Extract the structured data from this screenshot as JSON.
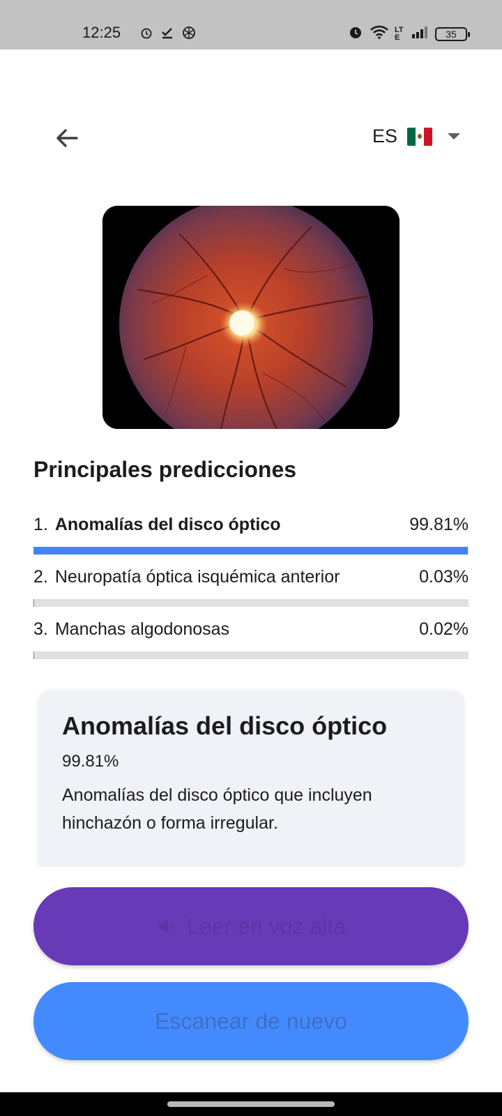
{
  "status_bar": {
    "time": "12:25",
    "battery": "35",
    "network": "LTE"
  },
  "header": {
    "language_code": "ES",
    "flag": "mexico-flag"
  },
  "predictions": {
    "title": "Principales predicciones",
    "items": [
      {
        "rank": "1.",
        "name": "Anomalías del disco óptico",
        "percent": "99.81%",
        "value": 0.9981
      },
      {
        "rank": "2.",
        "name": "Neuropatía óptica isquémica anterior",
        "percent": "0.03%",
        "value": 0.0003
      },
      {
        "rank": "3.",
        "name": "Manchas algodonosas",
        "percent": "0.02%",
        "value": 0.0002
      }
    ]
  },
  "detail": {
    "title": "Anomalías del disco óptico",
    "percent": "99.81%",
    "description": "Anomalías del disco óptico que incluyen hinchazón o forma irregular."
  },
  "actions": {
    "speak_label": "Leer en voz alta",
    "scan_label": "Escanear de nuevo"
  },
  "colors": {
    "accent_blue": "#4285f4",
    "purple": "#673ab7",
    "button_blue": "#448aff"
  }
}
